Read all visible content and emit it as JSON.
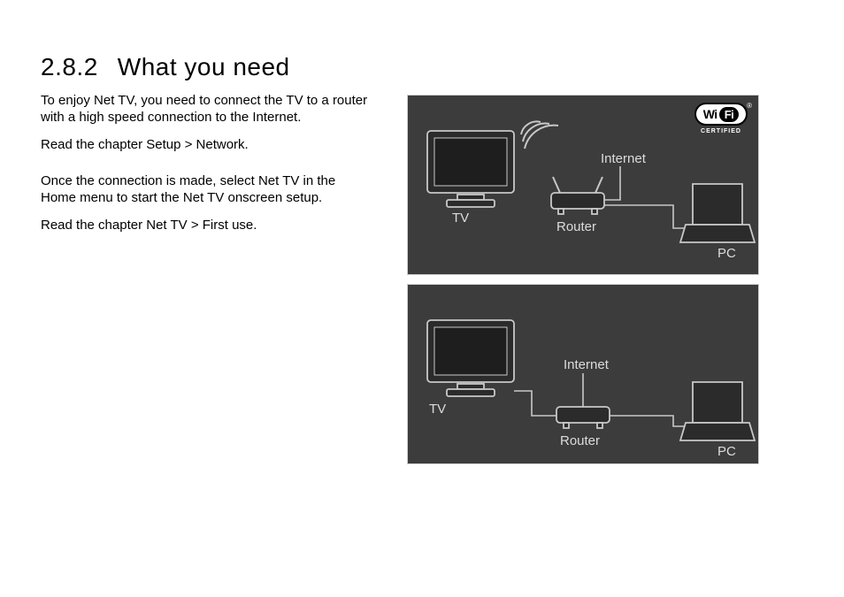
{
  "section": {
    "number": "2.8.2",
    "title": "What you need"
  },
  "paragraphs": {
    "p1": "To enjoy Net TV, you need to connect the TV to a router with a high speed connection to the Internet.",
    "p2": "Read the chapter Setup > Network.",
    "p3": "Once the connection is made, select Net TV in the Home menu to start the Net TV onscreen setup.",
    "p4": "Read the chapter Net TV > First use."
  },
  "diagram": {
    "top": {
      "tv": "TV",
      "router": "Router",
      "pc": "PC",
      "internet": "Internet"
    },
    "bottom": {
      "tv": "TV",
      "router": "Router",
      "pc": "PC",
      "internet": "Internet"
    },
    "wifi": {
      "wi": "Wi",
      "fi": "Fi",
      "certified": "CERTIFIED",
      "reg": "®"
    }
  }
}
